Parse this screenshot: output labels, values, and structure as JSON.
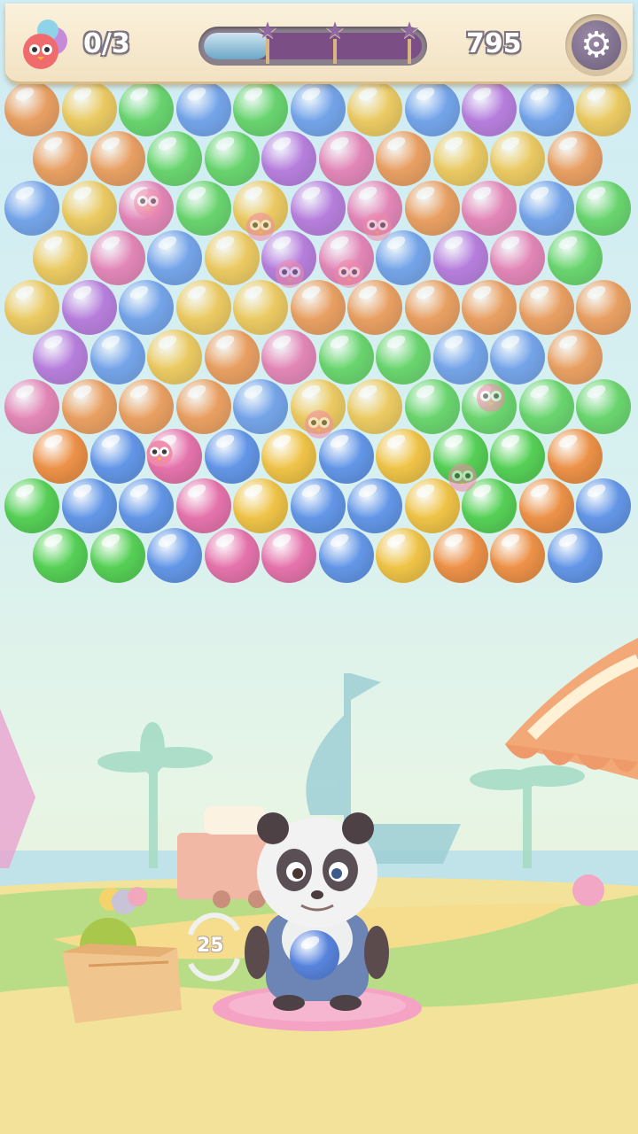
{
  "hud": {
    "birds_rescued": "0/3",
    "score": "795",
    "progress_fraction": 0.3,
    "star_count": 3,
    "settings_icon": "gear-icon"
  },
  "shooter": {
    "balls_left": "25",
    "current_bubble_color": "#5a86e0"
  },
  "colors": {
    "orange": "#f08a3a",
    "yellow": "#f3c13a",
    "green": "#4ccf4a",
    "blue": "#5a90e8",
    "purple": "#b060d8",
    "pink": "#e86aa8",
    "red": "#e8503a"
  },
  "grid": {
    "rows": [
      [
        "orange",
        "yellow",
        "green",
        "blue",
        "green",
        "blue",
        "yellow",
        "blue",
        "purple",
        "blue",
        "yellow"
      ],
      [
        "orange",
        "orange",
        "green",
        "green",
        "purple",
        "pink",
        "orange",
        "yellow",
        "yellow",
        "orange"
      ],
      [
        "blue",
        "yellow",
        "pink",
        "green",
        "yellow",
        "purple",
        "pink",
        "orange",
        "pink",
        "blue",
        "green"
      ],
      [
        "yellow",
        "pink",
        "blue",
        "yellow",
        "purple",
        "pink",
        "blue",
        "purple",
        "pink",
        "green"
      ],
      [
        "yellow",
        "purple",
        "blue",
        "yellow",
        "yellow",
        "orange",
        "orange",
        "orange",
        "orange",
        "orange",
        "orange"
      ],
      [
        "purple",
        "blue",
        "yellow",
        "orange",
        "pink",
        "green",
        "green",
        "blue",
        "blue",
        "orange"
      ],
      [
        "pink",
        "orange",
        "orange",
        "orange",
        "blue",
        "yellow",
        "yellow",
        "green",
        "green",
        "green",
        "green"
      ],
      [
        "orange",
        "blue",
        "pink",
        "blue",
        "yellow",
        "blue",
        "yellow",
        "green",
        "green",
        "orange"
      ],
      [
        "green",
        "blue",
        "blue",
        "pink",
        "yellow",
        "blue",
        "blue",
        "yellow",
        "green",
        "orange",
        "blue"
      ],
      [
        "green",
        "green",
        "blue",
        "pink",
        "pink",
        "blue",
        "yellow",
        "orange",
        "orange",
        "blue"
      ]
    ]
  }
}
